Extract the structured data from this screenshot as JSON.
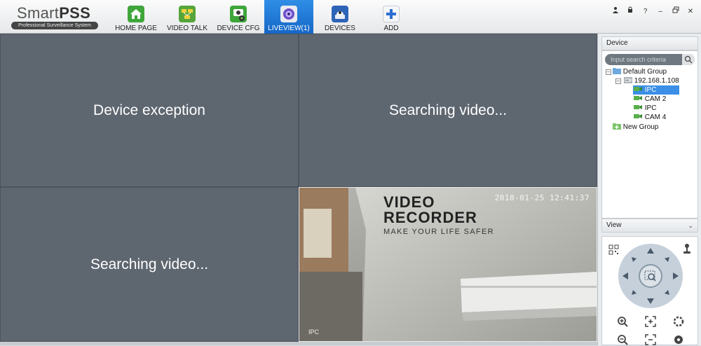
{
  "app": {
    "logo_main": "Smart",
    "logo_bold": "PSS",
    "logo_sub": "Professional Surveillance System"
  },
  "nav": [
    {
      "label": "HOME PAGE",
      "icon": "home-icon",
      "color": "#3ea63a"
    },
    {
      "label": "VIDEO TALK",
      "icon": "video-talk-icon",
      "color": "#55a63a"
    },
    {
      "label": "DEVICE CFG",
      "icon": "device-cfg-icon",
      "color": "#3ea63a"
    },
    {
      "label": "LIVEVIEW(1)",
      "icon": "liveview-icon",
      "color": "#6d4fc6",
      "active": true
    },
    {
      "label": "DEVICES",
      "icon": "devices-icon",
      "color": "#2e64b8"
    },
    {
      "label": "ADD",
      "icon": "add-icon",
      "color": "#2b6fd1"
    }
  ],
  "window_controls": [
    "user-icon",
    "lock-icon",
    "help-icon",
    "minimize-icon",
    "restore-icon",
    "close-icon"
  ],
  "liveview": {
    "cell1": "Device exception",
    "cell2": "Searching video...",
    "cell3": "Searching video...",
    "feed_label_1": "VIDEO",
    "feed_label_2": "RECORDER",
    "feed_label_3": "MAKE YOUR LIFE SAFER",
    "feed_timestamp": "2018-01-25 12:41:37",
    "feed_camera": "IPC"
  },
  "panel": {
    "device_header": "Device",
    "search_placeholder": "Input search criteria",
    "tree": [
      {
        "label": "Default Group",
        "level": 0,
        "icon": "folder-icon"
      },
      {
        "label": "192.168.1.108",
        "level": 1,
        "icon": "dvr-icon"
      },
      {
        "label": "IPC",
        "level": 2,
        "icon": "camera-icon",
        "selected": true
      },
      {
        "label": "CAM 2",
        "level": 2,
        "icon": "camera-icon"
      },
      {
        "label": "IPC",
        "level": 2,
        "icon": "camera-icon"
      },
      {
        "label": "CAM 4",
        "level": 2,
        "icon": "camera-icon"
      },
      {
        "label": "New Group",
        "level": 0,
        "icon": "folder-add-icon"
      }
    ],
    "view_header": "View"
  }
}
